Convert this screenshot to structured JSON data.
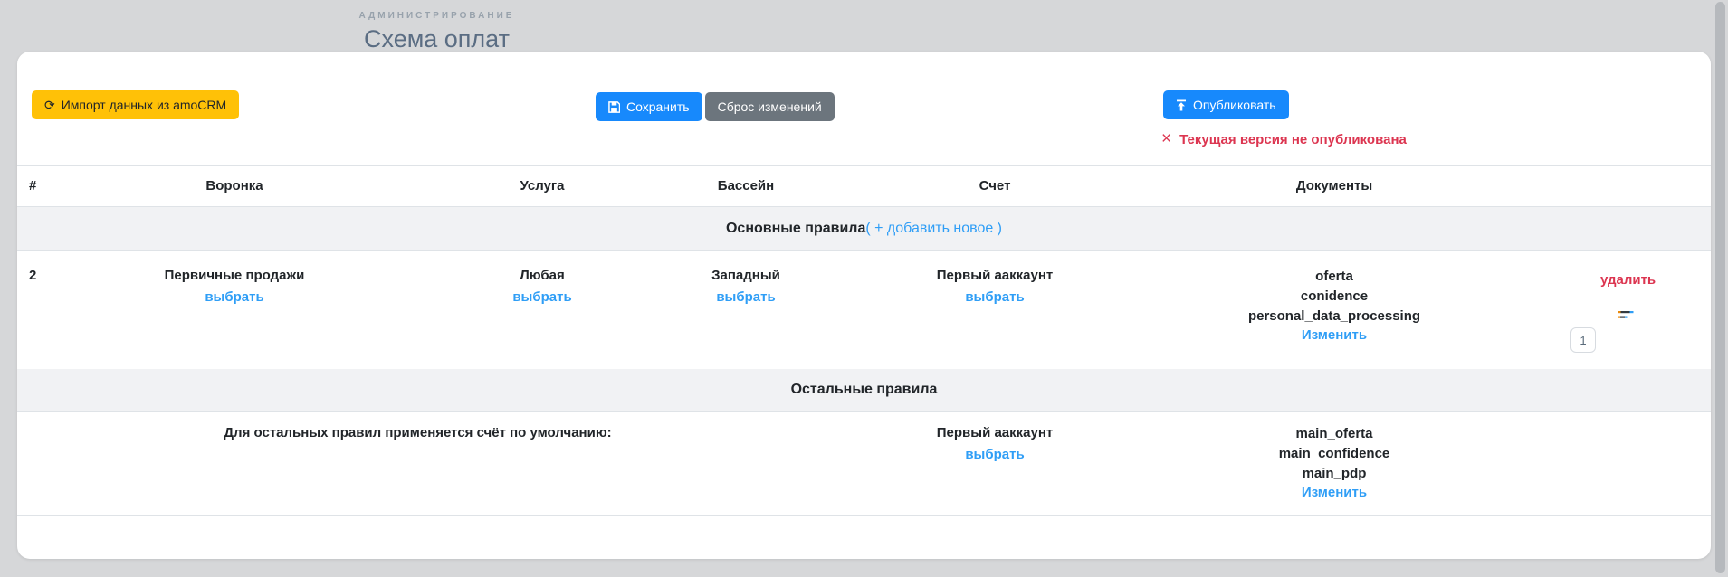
{
  "page": {
    "eyebrow": "АДМИНИСТРИРОВАНИЕ",
    "title": "Схема оплат"
  },
  "toolbar": {
    "import_label": "Импорт данных из amoCRM",
    "save_label": "Сохранить",
    "reset_label": "Сброс изменений",
    "publish_label": "Опубликовать",
    "status_text": "Текущая версия не опубликована",
    "refresh_icon": "⟳",
    "x_icon": "×"
  },
  "colors": {
    "accent_blue": "#1789fc",
    "link_blue": "#2f9ef6",
    "danger_red": "#dc3550",
    "amber": "#ffc107",
    "gray_button": "#6c757d",
    "page_background": "#d6d7d9",
    "section_row_background": "#f1f2f4"
  },
  "table": {
    "headers": {
      "num": "#",
      "funnel": "Воронка",
      "service": "Услуга",
      "pool": "Бассейн",
      "account": "Счет",
      "documents": "Документы"
    },
    "sections": {
      "main_title": "Основные правила",
      "main_add_link": "( + добавить новое )",
      "other_title": "Остальные правила"
    },
    "rows": [
      {
        "num": "2",
        "funnel": "Первичные продажи",
        "service": "Любая",
        "pool": "Западный",
        "account": "Первый ааккаунт",
        "choose_label": "выбрать",
        "documents": [
          "oferta",
          "conidence",
          "personal_data_processing"
        ],
        "edit_label": "Изменить",
        "delete_label": "удалить",
        "order_value": "1"
      }
    ],
    "default_row": {
      "description": "Для остальных правил применяется счёт по умолчанию:",
      "account": "Первый ааккаунт",
      "choose_label": "выбрать",
      "documents": [
        "main_oferta",
        "main_confidence",
        "main_pdp"
      ],
      "edit_label": "Изменить"
    }
  }
}
